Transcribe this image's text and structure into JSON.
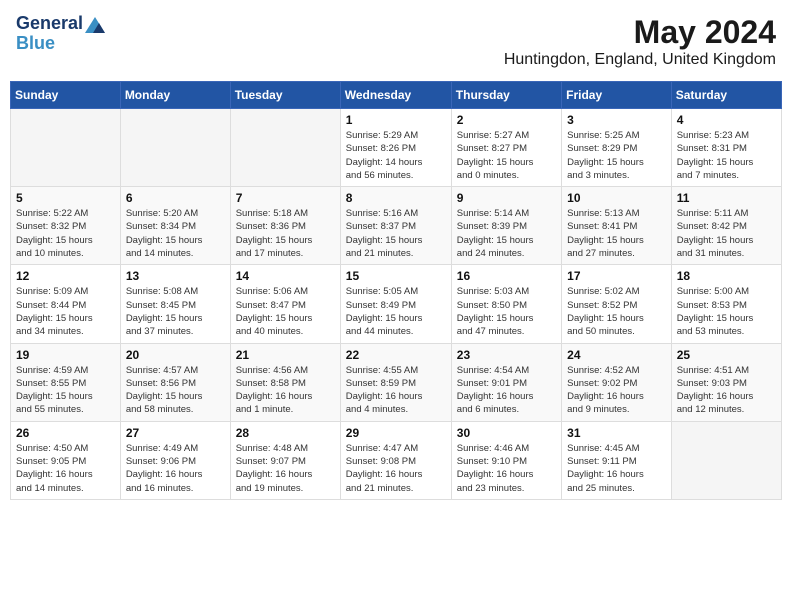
{
  "header": {
    "logo_general": "General",
    "logo_blue": "Blue",
    "title": "May 2024",
    "subtitle": "Huntingdon, England, United Kingdom"
  },
  "weekdays": [
    "Sunday",
    "Monday",
    "Tuesday",
    "Wednesday",
    "Thursday",
    "Friday",
    "Saturday"
  ],
  "weeks": [
    [
      {
        "day": "",
        "info": ""
      },
      {
        "day": "",
        "info": ""
      },
      {
        "day": "",
        "info": ""
      },
      {
        "day": "1",
        "info": "Sunrise: 5:29 AM\nSunset: 8:26 PM\nDaylight: 14 hours\nand 56 minutes."
      },
      {
        "day": "2",
        "info": "Sunrise: 5:27 AM\nSunset: 8:27 PM\nDaylight: 15 hours\nand 0 minutes."
      },
      {
        "day": "3",
        "info": "Sunrise: 5:25 AM\nSunset: 8:29 PM\nDaylight: 15 hours\nand 3 minutes."
      },
      {
        "day": "4",
        "info": "Sunrise: 5:23 AM\nSunset: 8:31 PM\nDaylight: 15 hours\nand 7 minutes."
      }
    ],
    [
      {
        "day": "5",
        "info": "Sunrise: 5:22 AM\nSunset: 8:32 PM\nDaylight: 15 hours\nand 10 minutes."
      },
      {
        "day": "6",
        "info": "Sunrise: 5:20 AM\nSunset: 8:34 PM\nDaylight: 15 hours\nand 14 minutes."
      },
      {
        "day": "7",
        "info": "Sunrise: 5:18 AM\nSunset: 8:36 PM\nDaylight: 15 hours\nand 17 minutes."
      },
      {
        "day": "8",
        "info": "Sunrise: 5:16 AM\nSunset: 8:37 PM\nDaylight: 15 hours\nand 21 minutes."
      },
      {
        "day": "9",
        "info": "Sunrise: 5:14 AM\nSunset: 8:39 PM\nDaylight: 15 hours\nand 24 minutes."
      },
      {
        "day": "10",
        "info": "Sunrise: 5:13 AM\nSunset: 8:41 PM\nDaylight: 15 hours\nand 27 minutes."
      },
      {
        "day": "11",
        "info": "Sunrise: 5:11 AM\nSunset: 8:42 PM\nDaylight: 15 hours\nand 31 minutes."
      }
    ],
    [
      {
        "day": "12",
        "info": "Sunrise: 5:09 AM\nSunset: 8:44 PM\nDaylight: 15 hours\nand 34 minutes."
      },
      {
        "day": "13",
        "info": "Sunrise: 5:08 AM\nSunset: 8:45 PM\nDaylight: 15 hours\nand 37 minutes."
      },
      {
        "day": "14",
        "info": "Sunrise: 5:06 AM\nSunset: 8:47 PM\nDaylight: 15 hours\nand 40 minutes."
      },
      {
        "day": "15",
        "info": "Sunrise: 5:05 AM\nSunset: 8:49 PM\nDaylight: 15 hours\nand 44 minutes."
      },
      {
        "day": "16",
        "info": "Sunrise: 5:03 AM\nSunset: 8:50 PM\nDaylight: 15 hours\nand 47 minutes."
      },
      {
        "day": "17",
        "info": "Sunrise: 5:02 AM\nSunset: 8:52 PM\nDaylight: 15 hours\nand 50 minutes."
      },
      {
        "day": "18",
        "info": "Sunrise: 5:00 AM\nSunset: 8:53 PM\nDaylight: 15 hours\nand 53 minutes."
      }
    ],
    [
      {
        "day": "19",
        "info": "Sunrise: 4:59 AM\nSunset: 8:55 PM\nDaylight: 15 hours\nand 55 minutes."
      },
      {
        "day": "20",
        "info": "Sunrise: 4:57 AM\nSunset: 8:56 PM\nDaylight: 15 hours\nand 58 minutes."
      },
      {
        "day": "21",
        "info": "Sunrise: 4:56 AM\nSunset: 8:58 PM\nDaylight: 16 hours\nand 1 minute."
      },
      {
        "day": "22",
        "info": "Sunrise: 4:55 AM\nSunset: 8:59 PM\nDaylight: 16 hours\nand 4 minutes."
      },
      {
        "day": "23",
        "info": "Sunrise: 4:54 AM\nSunset: 9:01 PM\nDaylight: 16 hours\nand 6 minutes."
      },
      {
        "day": "24",
        "info": "Sunrise: 4:52 AM\nSunset: 9:02 PM\nDaylight: 16 hours\nand 9 minutes."
      },
      {
        "day": "25",
        "info": "Sunrise: 4:51 AM\nSunset: 9:03 PM\nDaylight: 16 hours\nand 12 minutes."
      }
    ],
    [
      {
        "day": "26",
        "info": "Sunrise: 4:50 AM\nSunset: 9:05 PM\nDaylight: 16 hours\nand 14 minutes."
      },
      {
        "day": "27",
        "info": "Sunrise: 4:49 AM\nSunset: 9:06 PM\nDaylight: 16 hours\nand 16 minutes."
      },
      {
        "day": "28",
        "info": "Sunrise: 4:48 AM\nSunset: 9:07 PM\nDaylight: 16 hours\nand 19 minutes."
      },
      {
        "day": "29",
        "info": "Sunrise: 4:47 AM\nSunset: 9:08 PM\nDaylight: 16 hours\nand 21 minutes."
      },
      {
        "day": "30",
        "info": "Sunrise: 4:46 AM\nSunset: 9:10 PM\nDaylight: 16 hours\nand 23 minutes."
      },
      {
        "day": "31",
        "info": "Sunrise: 4:45 AM\nSunset: 9:11 PM\nDaylight: 16 hours\nand 25 minutes."
      },
      {
        "day": "",
        "info": ""
      }
    ]
  ]
}
